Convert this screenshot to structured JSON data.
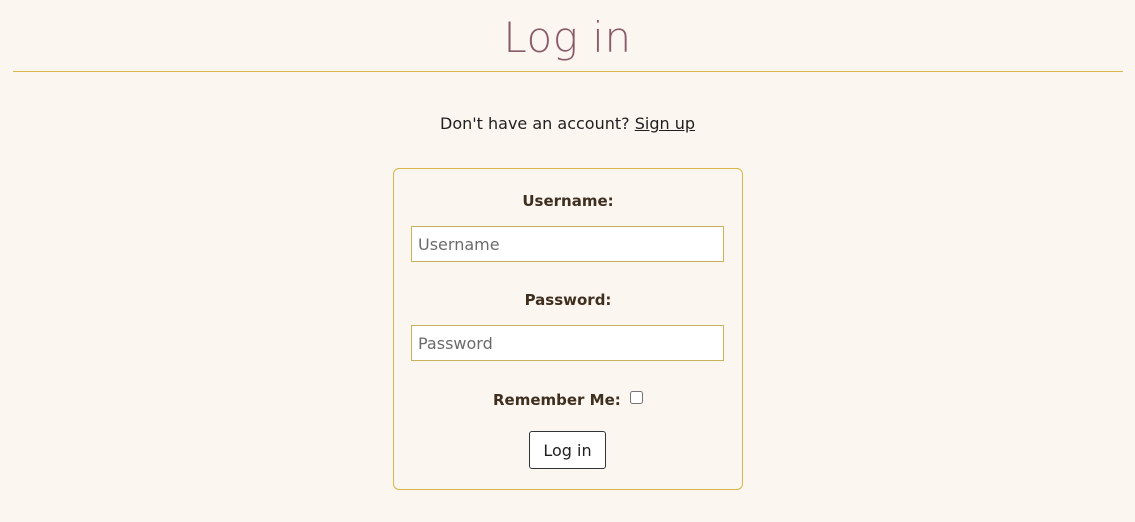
{
  "page": {
    "title": "Log in"
  },
  "signup": {
    "prompt": "Don't have an account?",
    "link_label": "Sign up"
  },
  "form": {
    "username": {
      "label": "Username:",
      "placeholder": "Username",
      "value": ""
    },
    "password": {
      "label": "Password:",
      "placeholder": "Password",
      "value": ""
    },
    "remember": {
      "label": "Remember Me:",
      "checked": false
    },
    "submit_label": "Log in"
  },
  "colors": {
    "background": "#fcf6f1",
    "title": "#8a5c6a",
    "accent_border": "#d7b64a",
    "label_text": "#3f2f1f"
  }
}
